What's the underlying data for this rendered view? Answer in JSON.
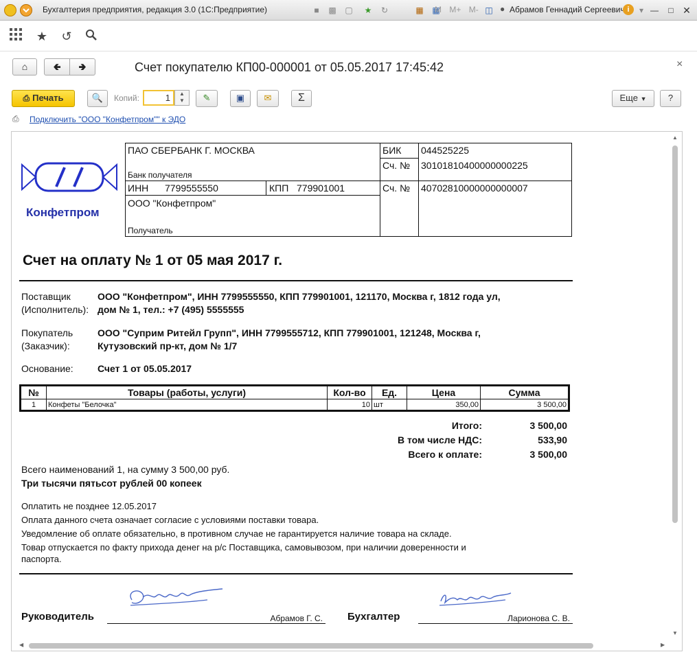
{
  "window": {
    "title": "Бухгалтерия предприятия, редакция 3.0  (1С:Предприятие)",
    "user": "Абрамов Геннадий Сергеевич",
    "memory_buttons": [
      "M",
      "M+",
      "M-"
    ]
  },
  "doc": {
    "title": "Счет покупателю КП00-000001 от 05.05.2017 17:45:42"
  },
  "commandbar": {
    "print_label": "Печать",
    "copies_label": "Копий:",
    "copies_value": "1",
    "more_label": "Еще",
    "help_label": "?",
    "sum_symbol": "Σ"
  },
  "edo_link": "Подключить \"ООО \"Конфетпром\"\" к ЭДО",
  "invoice": {
    "logo_text": "Конфетпром",
    "bank": {
      "name": "ПАО СБЕРБАНК Г. МОСКВА",
      "recipient_bank_label": "Банк получателя",
      "bik_label": "БИК",
      "bik": "044525225",
      "acc_label": "Сч. №",
      "corr_account": "30101810400000000225",
      "inn_label": "ИНН",
      "inn": "7799555550",
      "kpp_label": "КПП",
      "kpp": "779901001",
      "account": "40702810000000000007",
      "recipient_name": "ООО \"Конфетпром\"",
      "recipient_label": "Получатель"
    },
    "heading": "Счет на оплату № 1 от 05 мая 2017 г.",
    "supplier_label1": "Поставщик",
    "supplier_label2": "(Исполнитель):",
    "supplier_line1": "ООО \"Конфетпром\", ИНН 7799555550, КПП 779901001, 121170, Москва г, 1812 года ул,",
    "supplier_line2": "дом № 1, тел.: +7 (495) 5555555",
    "buyer_label1": "Покупатель",
    "buyer_label2": "(Заказчик):",
    "buyer_line1": "ООО \"Суприм Ритейл Групп\", ИНН 7799555712, КПП 779901001, 121248, Москва г,",
    "buyer_line2": "Кутузовский пр-кт, дом № 1/7",
    "basis_label": "Основание:",
    "basis_value": "Счет 1 от 05.05.2017",
    "table": {
      "headers": [
        "№",
        "Товары (работы, услуги)",
        "Кол-во",
        "Ед.",
        "Цена",
        "Сумма"
      ],
      "rows": [
        [
          "1",
          "Конфеты \"Белочка\"",
          "10",
          "шт",
          "350,00",
          "3 500,00"
        ]
      ]
    },
    "totals": [
      {
        "label": "Итого:",
        "value": "3 500,00"
      },
      {
        "label": "В том числе НДС:",
        "value": "533,90"
      },
      {
        "label": "Всего к оплате:",
        "value": "3 500,00"
      }
    ],
    "summary_line": "Всего наименований 1, на сумму 3 500,00 руб.",
    "amount_words": "Три тысячи пятьсот рублей 00 копеек",
    "notes": [
      "Оплатить не позднее 12.05.2017",
      "Оплата данного счета означает согласие с условиями поставки товара.",
      "Уведомление об оплате обязательно, в противном случае не гарантируется наличие товара на складе.",
      "Товар отпускается по факту прихода денег на р/с Поставщика, самовывозом, при наличии доверенности и",
      "паспорта."
    ],
    "director_label": "Руководитель",
    "director_name": "Абрамов Г. С.",
    "accountant_label": "Бухгалтер",
    "accountant_name": "Ларионова С. В."
  }
}
